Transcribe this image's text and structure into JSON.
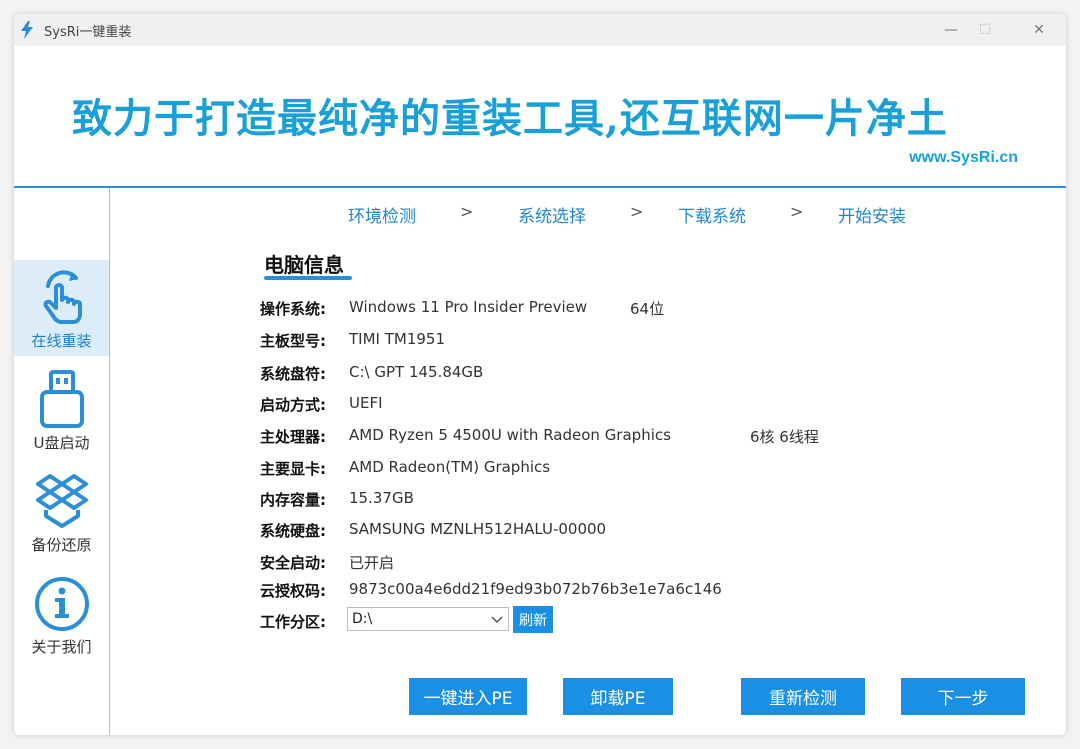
{
  "window": {
    "title": "SysRi一键重装",
    "controls": {
      "minimize": "—",
      "maximize": "☐",
      "close": "✕"
    }
  },
  "banner": {
    "slogan": "致力于打造最纯净的重装工具,还互联网一片净土",
    "url": "www.SysRi.cn"
  },
  "sidebar": {
    "items": [
      {
        "label": "在线重装",
        "icon": "hand-click-icon",
        "active": true
      },
      {
        "label": "U盘启动",
        "icon": "usb-drive-icon",
        "active": false
      },
      {
        "label": "备份还原",
        "icon": "dropbox-cube-icon",
        "active": false
      },
      {
        "label": "关于我们",
        "icon": "info-circle-icon",
        "active": false
      }
    ]
  },
  "steps": [
    "环境检测",
    "系统选择",
    "下载系统",
    "开始安装"
  ],
  "step_separator": ">",
  "section_title": "电脑信息",
  "info": [
    {
      "label": "操作系统:",
      "value": "Windows 11 Pro Insider Preview",
      "extra": "64位"
    },
    {
      "label": "主板型号:",
      "value": "TIMI TM1951"
    },
    {
      "label": "系统盘符:",
      "value": "C:\\ GPT 145.84GB"
    },
    {
      "label": "启动方式:",
      "value": "UEFI"
    },
    {
      "label": "主处理器:",
      "value": "AMD Ryzen 5 4500U with Radeon Graphics",
      "extra": "6核 6线程"
    },
    {
      "label": "主要显卡:",
      "value": "AMD Radeon(TM) Graphics"
    },
    {
      "label": "内存容量:",
      "value": "15.37GB"
    },
    {
      "label": "系统硬盘:",
      "value": "SAMSUNG MZNLH512HALU-00000"
    },
    {
      "label": "安全启动:",
      "value": "已开启"
    },
    {
      "label": "云授权码:",
      "value": "9873c00a4e6dd21f9ed93b072b76b3e1e7a6c146"
    }
  ],
  "partition": {
    "label": "工作分区:",
    "selected": "D:\\",
    "refresh_label": "刷新"
  },
  "buttons": {
    "enter_pe": "一键进入PE",
    "uninstall_pe": "卸载PE",
    "recheck": "重新检测",
    "next": "下一步"
  },
  "colors": {
    "accent": "#1a8fe3",
    "banner_text": "#1aa0d8",
    "sidebar_active_bg": "#dcecf9"
  }
}
